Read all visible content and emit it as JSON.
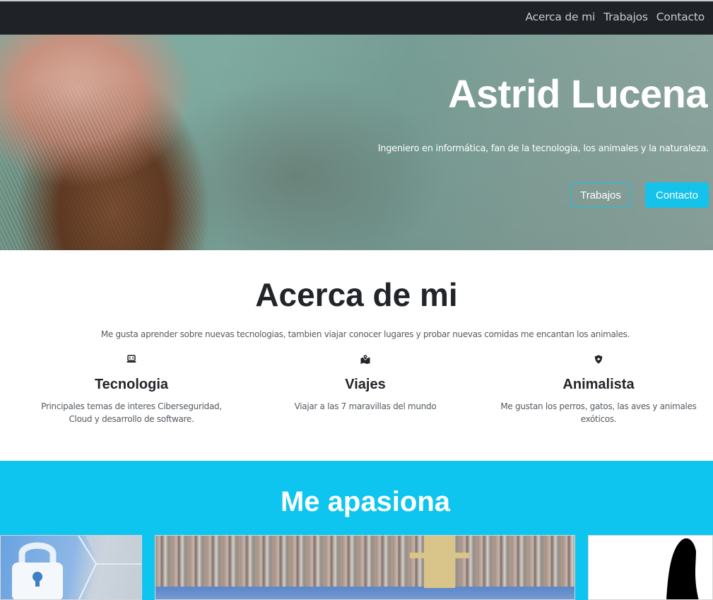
{
  "nav": {
    "links": [
      "Acerca de mi",
      "Trabajos",
      "Contacto"
    ]
  },
  "hero": {
    "title": "Astrid Lucena",
    "subtitle": "Ingeniero en informática, fan de la tecnologia, los animales y la naturaleza.",
    "btn_works": "Trabajos",
    "btn_contact": "Contacto"
  },
  "about": {
    "title": "Acerca de mi",
    "description": "Me gusta aprender sobre nuevas tecnologias, tambien viajar conocer lugares y probar nuevas comidas me encantan los animales.",
    "features": [
      {
        "icon": "laptop-code-icon",
        "title": "Tecnologia",
        "text": "Principales temas de interes Ciberseguridad, Cloud y desarrollo de software."
      },
      {
        "icon": "map-marked-icon",
        "title": "Viajes",
        "text": "Viajar a las 7 maravillas del mundo"
      },
      {
        "icon": "shield-dog-icon",
        "title": "Animalista",
        "text": "Me gustan los perros, gatos, las aves y animales exóticos."
      }
    ]
  },
  "passion": {
    "title": "Me apasiona"
  },
  "colors": {
    "navbar": "#1f2327",
    "accent": "#15c2ea",
    "passion_bg": "#0dc5ee"
  }
}
